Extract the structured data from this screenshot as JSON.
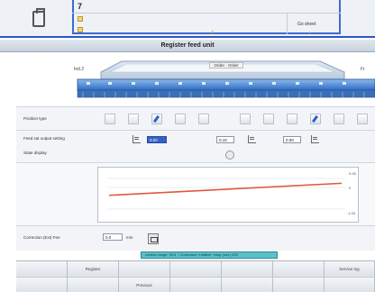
{
  "header": {
    "page_number": "7",
    "goto_label": "Go sheet",
    "marker_mid": "A",
    "marker_right": "+"
  },
  "title": "Register feed unit",
  "diagram": {
    "left_label": "Ind.2",
    "right_label": "Fr",
    "center_pill": "Order · Order"
  },
  "rows": {
    "position_label": "Position type",
    "feed_label": "Feed sat output setting",
    "state_label": "State display",
    "correction_label": "Correction (Ext) Fee",
    "correction_value": "0.0",
    "correction_unit": "mm"
  },
  "fields": {
    "f1": "0.00",
    "f2": "0.10",
    "f3": "0.00"
  },
  "chart_axis": {
    "top": "0.05",
    "mid": "0",
    "bottom": "-1.00"
  },
  "chart_data": {
    "type": "line",
    "title": "",
    "xlabel": "",
    "ylabel": "",
    "ylim": [
      -1.0,
      0.05
    ],
    "series": [
      {
        "values": [
          -0.47,
          -0.21
        ]
      }
    ]
  },
  "status": "Limited range: 99.6    ↑    Correction   +relative   +stop (incl.) 200",
  "softkeys_top": [
    "",
    "Register",
    "",
    "",
    "",
    "",
    "Service log"
  ],
  "softkeys_bottom": [
    "",
    "",
    "Previous",
    "",
    "",
    "",
    ""
  ],
  "colors": {
    "accent_blue": "#2b56c8",
    "line_red": "#e0593c",
    "status_teal": "#5cc0c8"
  }
}
